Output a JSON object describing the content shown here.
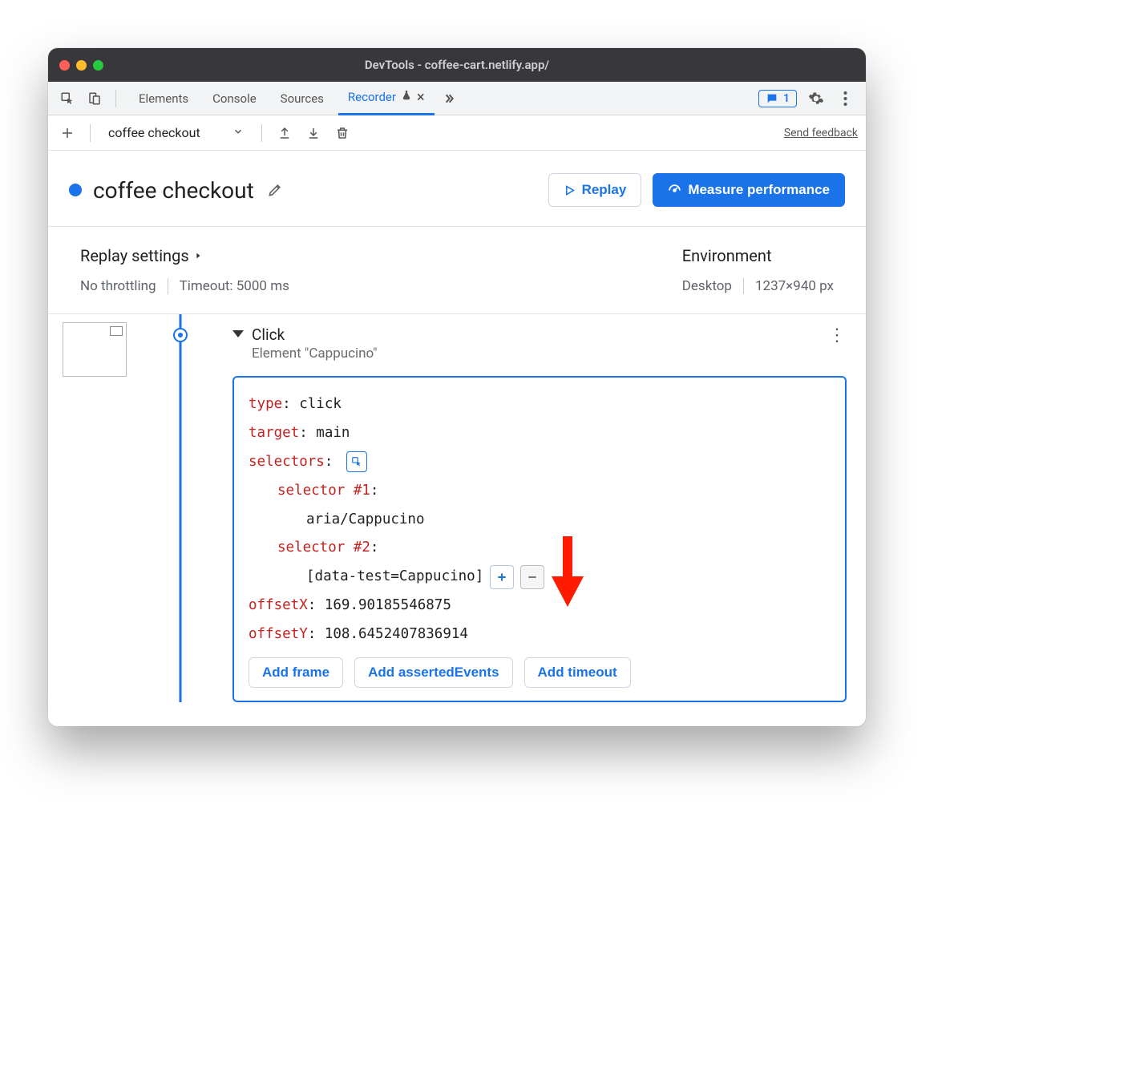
{
  "window": {
    "title": "DevTools - coffee-cart.netlify.app/"
  },
  "tabs": {
    "items": [
      "Elements",
      "Console",
      "Sources",
      "Recorder"
    ],
    "active": "Recorder",
    "badge_count": "1"
  },
  "toolbar": {
    "recording_name": "coffee checkout",
    "send_feedback": "Send feedback"
  },
  "recording": {
    "title": "coffee checkout",
    "replay_btn": "Replay",
    "measure_btn": "Measure performance"
  },
  "settings": {
    "replay_heading": "Replay settings",
    "throttling": "No throttling",
    "timeout": "Timeout: 5000 ms",
    "env_heading": "Environment",
    "device": "Desktop",
    "viewport": "1237×940 px"
  },
  "step": {
    "title": "Click",
    "subtitle": "Element \"Cappucino\"",
    "props": {
      "type_key": "type",
      "type_val": ": click",
      "target_key": "target",
      "target_val": ": main",
      "selectors_key": "selectors",
      "selectors_colon": ":",
      "sel1_key": "selector #1",
      "sel1_colon": ":",
      "sel1_val": "aria/Cappucino",
      "sel2_key": "selector #2",
      "sel2_colon": ":",
      "sel2_val": "[data-test=Cappucino]",
      "offx_key": "offsetX",
      "offx_val": ": 169.90185546875",
      "offy_key": "offsetY",
      "offy_val": ": 108.6452407836914"
    },
    "actions": {
      "add_frame": "Add frame",
      "add_asserted": "Add assertedEvents",
      "add_timeout": "Add timeout"
    }
  }
}
